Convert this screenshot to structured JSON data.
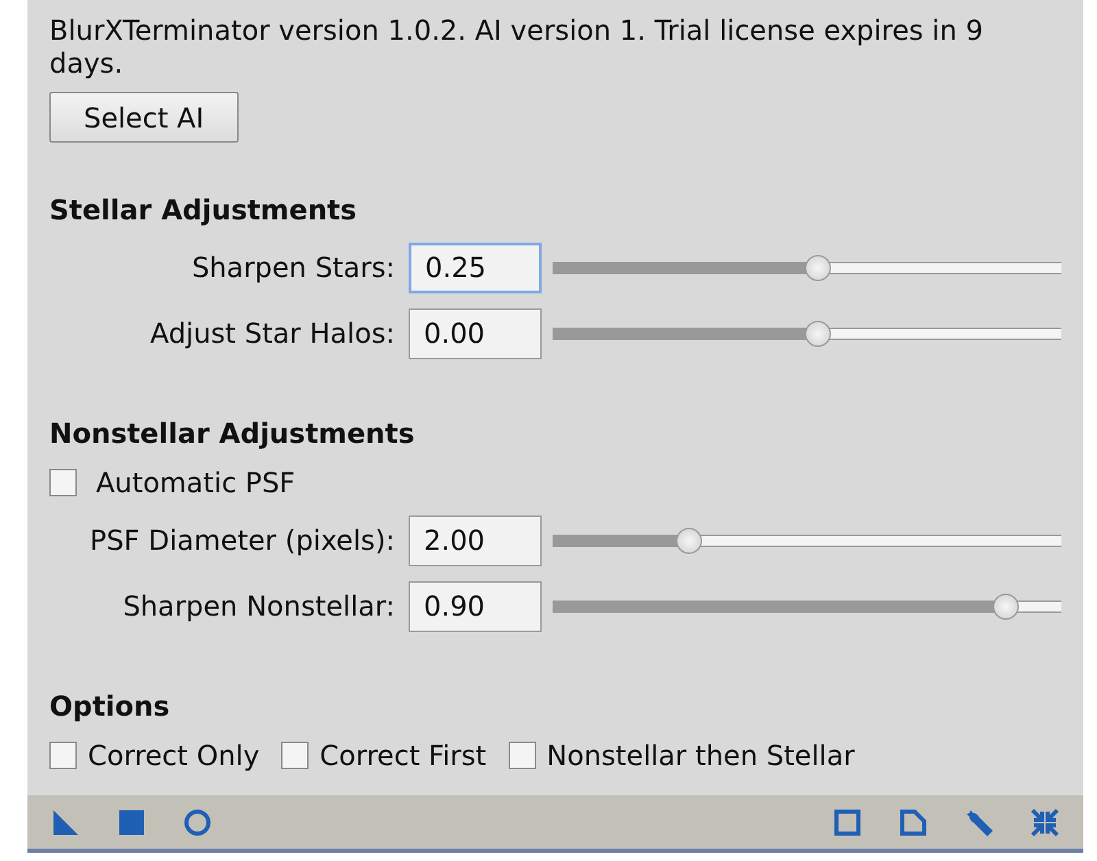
{
  "info_text": "BlurXTerminator version 1.0.2. AI version 1. Trial license expires in 9 days.",
  "select_button": "Select AI",
  "sections": [
    {
      "title": "Stellar Adjustments",
      "items": [
        {
          "kind": "slider",
          "label": "Sharpen Stars:",
          "value": "0.25",
          "focused": true,
          "level": 0.51
        },
        {
          "kind": "slider",
          "label": "Adjust Star Halos:",
          "value": "0.00",
          "focused": false,
          "level": 0.51
        }
      ]
    },
    {
      "title": "Nonstellar Adjustments",
      "items": [
        {
          "kind": "checkbox",
          "label": "Automatic PSF",
          "checked": false
        },
        {
          "kind": "slider",
          "label": "PSF Diameter (pixels):",
          "value": "2.00",
          "focused": false,
          "level": 0.25
        },
        {
          "kind": "slider",
          "label": "Sharpen Nonstellar:",
          "value": "0.90",
          "focused": false,
          "level": 0.89
        }
      ]
    },
    {
      "title": "Options",
      "items": [
        {
          "kind": "checkrow",
          "boxes": [
            {
              "label": "Correct Only",
              "checked": false
            },
            {
              "label": "Correct First",
              "checked": false
            },
            {
              "label": "Nonstellar then Stellar",
              "checked": false
            }
          ]
        }
      ]
    }
  ]
}
